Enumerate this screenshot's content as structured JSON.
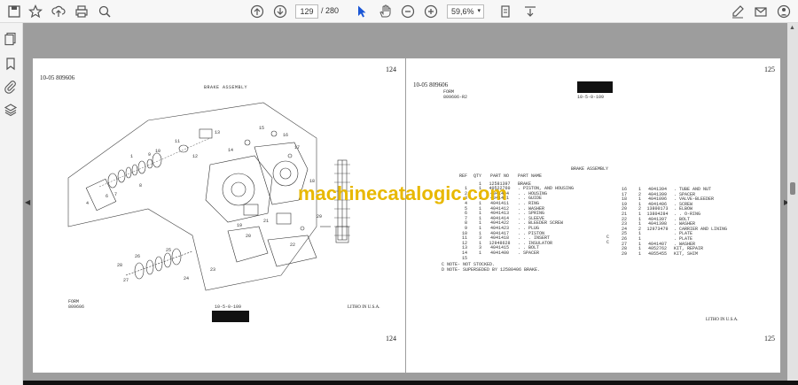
{
  "toolbar": {
    "page_current": "129",
    "page_total": "/ 280",
    "zoom": "59,6%",
    "icons": [
      "save-icon",
      "bookmark-star-icon",
      "upload-icon",
      "print-icon",
      "zoom-search-icon",
      "page-up-icon",
      "page-down-icon",
      "cursor-icon",
      "hand-icon",
      "zoom-out-icon",
      "zoom-in-icon",
      "fit-page-icon",
      "scroll-mode-icon",
      "sign-icon",
      "email-icon",
      "help-icon"
    ]
  },
  "sidebar": {
    "icons": [
      "pages-icon",
      "bookmarks-icon",
      "attachments-icon",
      "layers-icon"
    ]
  },
  "left_page": {
    "page_number_top": "124",
    "header": "10-05   809606",
    "title": "BRAKE ASSEMBLY",
    "form_label": "FORM",
    "form_number": "809606",
    "code": "10-5-0-109",
    "litho": "LITHO IN U.S.A.",
    "page_number_bottom": "124",
    "callouts": [
      "1",
      "4",
      "6",
      "7",
      "8",
      "9",
      "10",
      "11",
      "12",
      "13",
      "14",
      "15",
      "16",
      "17",
      "18",
      "19",
      "20",
      "21",
      "22",
      "23",
      "24",
      "25",
      "26",
      "27",
      "28",
      "29"
    ]
  },
  "right_page": {
    "page_number_top": "125",
    "header": "10-05   809606",
    "form_label": "FORM",
    "form_number": "809606-R2",
    "code": "10-5-0-109",
    "table_title": "BRAKE ASSEMBLY",
    "columns": [
      "REF",
      "QTY",
      "PART NO",
      "PART NAME"
    ],
    "left_rows": [
      [
        "",
        "1",
        "12581397",
        "BRAKE"
      ],
      [
        "1",
        "1",
        "40522760",
        ". PISTON, AND HOUSING"
      ],
      [
        "2",
        "1",
        "4041404",
        ". . HOUSING"
      ],
      [
        "3",
        "1",
        "4041421",
        ". . GUIDE"
      ],
      [
        "4",
        "1",
        "4041411",
        ". . RING"
      ],
      [
        "5",
        "1",
        "4041412",
        ". . WASHER"
      ],
      [
        "6",
        "1",
        "4041413",
        ". . SPRING"
      ],
      [
        "7",
        "1",
        "4041414",
        ". . SLEEVE"
      ],
      [
        "8",
        "1",
        "4041422",
        ". . BLEEDER SCREW"
      ],
      [
        "9",
        "1",
        "4041423",
        ". . PLUG"
      ],
      [
        "10",
        "1",
        "4041417",
        ". . PISTON"
      ],
      [
        "11",
        "3",
        "4041418",
        ". . . INSERT"
      ],
      [
        "12",
        "1",
        "12948628",
        ". . INSULATOR"
      ],
      [
        "13",
        "3",
        "4041415",
        ". . BOLT"
      ],
      [
        "14",
        "1",
        "4041400",
        ". SPACER"
      ],
      [
        "15",
        "",
        "",
        ""
      ]
    ],
    "right_rows": [
      [
        "16",
        "1",
        "4041394",
        ". TUBE AND NUT"
      ],
      [
        "17",
        "2",
        "4041399",
        ". SPACER"
      ],
      [
        "18",
        "1",
        "4041096",
        ". VALVE-BLEEDER"
      ],
      [
        "19",
        "1",
        "4041406",
        ". SCREW"
      ],
      [
        "20",
        "2",
        "13800173",
        ". ELBOW"
      ],
      [
        "21",
        "1",
        "13804284",
        ". . O-RING"
      ],
      [
        "22",
        "1",
        "4041397",
        ". BOLT"
      ],
      [
        "23",
        "1",
        "4041398",
        ". WASHER"
      ],
      [
        "24",
        "2",
        "12973479",
        ". CARRIER AND LINING"
      ],
      [
        "25",
        "1",
        "",
        ". PLATE"
      ],
      [
        "26",
        "1",
        "",
        ". PLATE"
      ],
      [
        "27",
        "1",
        "4041407",
        ". WASHER"
      ],
      [
        "28",
        "1",
        "4052762",
        "KIT, REPAIR"
      ],
      [
        "29",
        "1",
        "4055455",
        "KIT, SHIM"
      ]
    ],
    "c_marks": [
      "C",
      "C"
    ],
    "notes": [
      "C  NOTE- NOT STOCKED.",
      "D  NOTE- SUPERSEDED BY 12580406 BRAKE."
    ],
    "litho": "LITHO IN U.S.A.",
    "page_number_bottom": "125"
  },
  "watermark": "machinecatalogic.com",
  "colors": {
    "toolbar_bg": "#f7f7f7",
    "viewer_bg": "#9d9d9d",
    "cursor_blue": "#1a56d6",
    "watermark": "#e8b800"
  }
}
